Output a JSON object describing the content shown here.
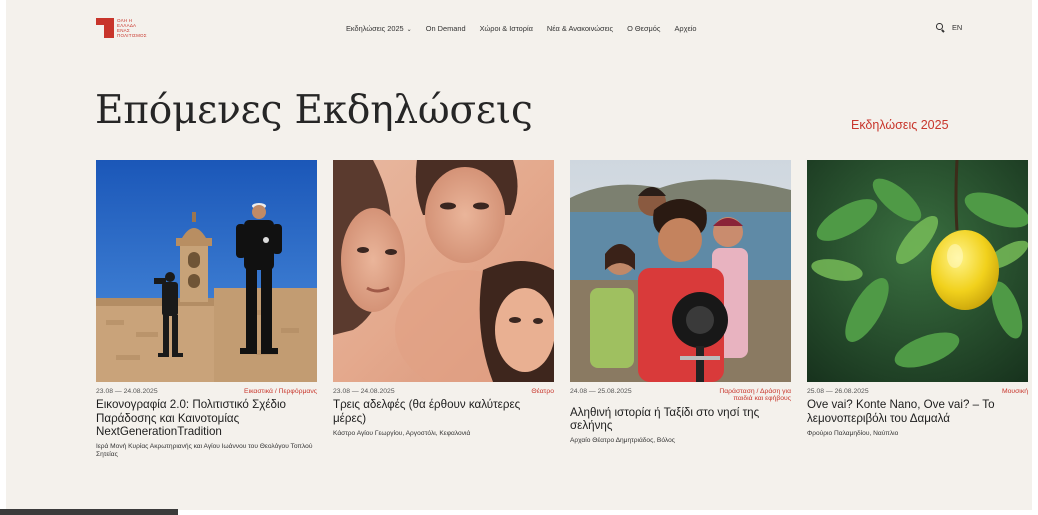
{
  "header": {
    "logo_lines": [
      "ΟΛΗ Η",
      "ΕΛΛΑΔΑ",
      "ΕΝΑΣ",
      "ΠΟΛΙΤΙΣΜΟΣ"
    ],
    "nav": [
      {
        "label": "Εκδηλώσεις 2025",
        "has_dropdown": true
      },
      {
        "label": "On Demand"
      },
      {
        "label": "Χώροι & Ιστορία"
      },
      {
        "label": "Νέα & Ανακοινώσεις"
      },
      {
        "label": "Ο Θεσμός"
      },
      {
        "label": "Αρχείο"
      }
    ],
    "language": "EN",
    "search_icon": "search-icon"
  },
  "main": {
    "title": "Επόμενες Εκδηλώσεις",
    "events_link": "Εκδηλώσεις 2025"
  },
  "cards": [
    {
      "date": "23.08 — 24.08.2025",
      "category": "Εικαστικά / Περφόρμανς",
      "title": "Εικονογραφία 2.0: Πολιτιστικό Σχέδιο Παράδοσης και Καινοτομίας NextGenerationTradition",
      "venue": "Ιερά Μονή Κυρίας Ακρωτηριανής και Αγίου Ιωάννου του Θεολόγου Τοπλού Σητείας"
    },
    {
      "date": "23.08 — 24.08.2025",
      "category": "Θέατρο",
      "title": "Τρεις αδελφές (θα έρθουν καλύτερες μέρες)",
      "venue": "Κάστρο Αγίου Γεωργίου, Αργοστόλι, Κεφαλονιά"
    },
    {
      "date": "24.08 — 25.08.2025",
      "category": "Παράσταση / Δράση για παιδιά και εφήβους",
      "title": "Αληθινή ιστορία ή Ταξίδι στο νησί της σελήνης",
      "venue": "Αρχαίο Θέατρο Δημητριάδος, Βόλος"
    },
    {
      "date": "25.08 — 26.08.2025",
      "category": "Μουσική",
      "title": "Ove vai? Konte Nano, Ove vai? – Το λεμονοπεριβόλι του Δαμαλά",
      "venue": "Φρούριο Παλαμηδίου, Ναύπλιο"
    }
  ],
  "colors": {
    "accent": "#c8352b",
    "background": "#f4f1ec",
    "text": "#1e1e1e"
  }
}
